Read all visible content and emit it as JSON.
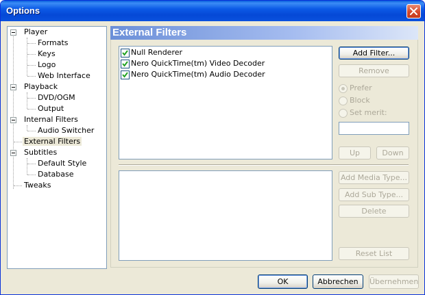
{
  "window": {
    "title": "Options"
  },
  "tree": {
    "items": [
      {
        "label": "Player",
        "expanded": true
      },
      {
        "label": "Formats"
      },
      {
        "label": "Keys"
      },
      {
        "label": "Logo"
      },
      {
        "label": "Web Interface"
      },
      {
        "label": "Playback",
        "expanded": true
      },
      {
        "label": "DVD/OGM"
      },
      {
        "label": "Output"
      },
      {
        "label": "Internal Filters",
        "expanded": true
      },
      {
        "label": "Audio Switcher"
      },
      {
        "label": "External Filters",
        "selected": true
      },
      {
        "label": "Subtitles",
        "expanded": true
      },
      {
        "label": "Default Style"
      },
      {
        "label": "Database"
      },
      {
        "label": "Tweaks"
      }
    ]
  },
  "panel": {
    "title": "External Filters"
  },
  "filters": [
    {
      "label": "Null Renderer",
      "checked": true
    },
    {
      "label": "Nero QuickTime(tm) Video Decoder",
      "checked": true
    },
    {
      "label": "Nero QuickTime(tm) Audio Decoder",
      "checked": true
    }
  ],
  "buttons": {
    "add_filter": "Add Filter...",
    "remove": "Remove",
    "up": "Up",
    "down": "Down",
    "add_media_type": "Add Media Type...",
    "add_sub_type": "Add Sub Type...",
    "delete": "Delete",
    "reset_list": "Reset List"
  },
  "merit": {
    "prefer": "Prefer",
    "block": "Block",
    "set_merit": "Set merit:",
    "selected": "prefer",
    "value": ""
  },
  "dialog_buttons": {
    "ok": "OK",
    "cancel": "Abbrechen",
    "apply": "Übernehmen"
  }
}
